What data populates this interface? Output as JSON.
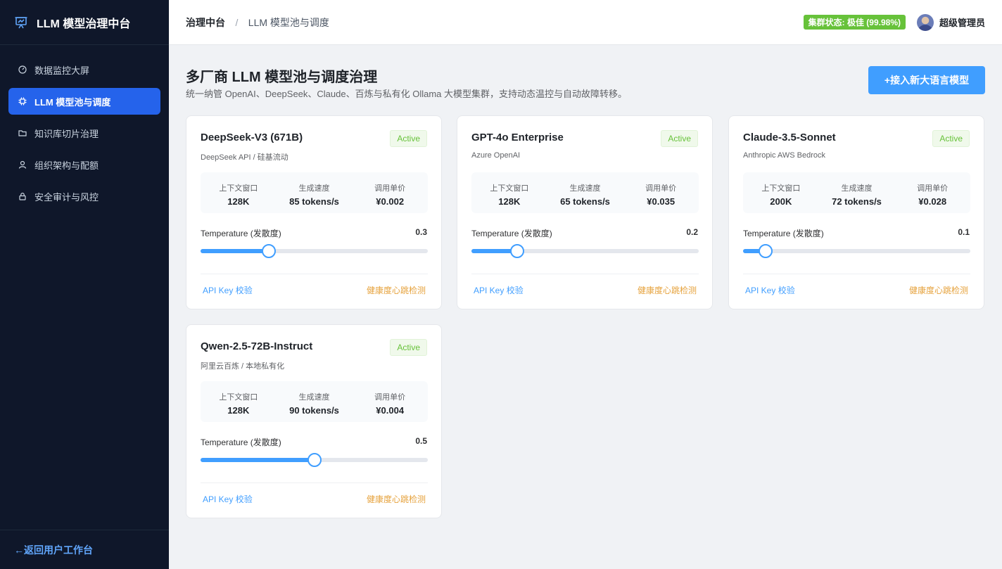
{
  "sidebar": {
    "brand": "LLM 模型治理中台",
    "items": [
      {
        "label": "数据监控大屏",
        "icon": "dashboard-icon",
        "active": false
      },
      {
        "label": "LLM 模型池与调度",
        "icon": "cpu-icon",
        "active": true
      },
      {
        "label": "知识库切片治理",
        "icon": "folder-icon",
        "active": false
      },
      {
        "label": "组织架构与配额",
        "icon": "user-icon",
        "active": false
      },
      {
        "label": "安全审计与风控",
        "icon": "lock-icon",
        "active": false
      }
    ],
    "back_label": "←返回用户工作台"
  },
  "header": {
    "breadcrumb_root": "治理中台",
    "breadcrumb_sep": "/",
    "breadcrumb_current": "LLM 模型池与调度",
    "cluster_status": "集群状态: 极佳 (99.98%)",
    "user_name": "超级管理员"
  },
  "page": {
    "title": "多厂商 LLM 模型池与调度治理",
    "subtitle": "统一纳管 OpenAI、DeepSeek、Claude、百炼与私有化 Ollama 大模型集群，支持动态温控与自动故障转移。",
    "add_button": "+接入新大语言模型"
  },
  "metric_labels": {
    "context": "上下文窗口",
    "speed": "生成速度",
    "price": "调用单价",
    "temperature": "Temperature (发散度)"
  },
  "card_links": {
    "api_key": "API Key 校验",
    "health": "健康度心跳检测"
  },
  "models": [
    {
      "name": "DeepSeek-V3 (671B)",
      "provider": "DeepSeek API / 硅基流动",
      "status": "Active",
      "context": "128K",
      "speed": "85 tokens/s",
      "price": "¥0.002",
      "temperature": "0.3",
      "temp_level": 0.3
    },
    {
      "name": "GPT-4o Enterprise",
      "provider": "Azure OpenAI",
      "status": "Active",
      "context": "128K",
      "speed": "65 tokens/s",
      "price": "¥0.035",
      "temperature": "0.2",
      "temp_level": 0.2
    },
    {
      "name": "Claude-3.5-Sonnet",
      "provider": "Anthropic AWS Bedrock",
      "status": "Active",
      "context": "200K",
      "speed": "72 tokens/s",
      "price": "¥0.028",
      "temperature": "0.1",
      "temp_level": 0.1
    },
    {
      "name": "Qwen-2.5-72B-Instruct",
      "provider": "阿里云百炼 / 本地私有化",
      "status": "Active",
      "context": "128K",
      "speed": "90 tokens/s",
      "price": "¥0.004",
      "temperature": "0.5",
      "temp_level": 0.5
    }
  ]
}
